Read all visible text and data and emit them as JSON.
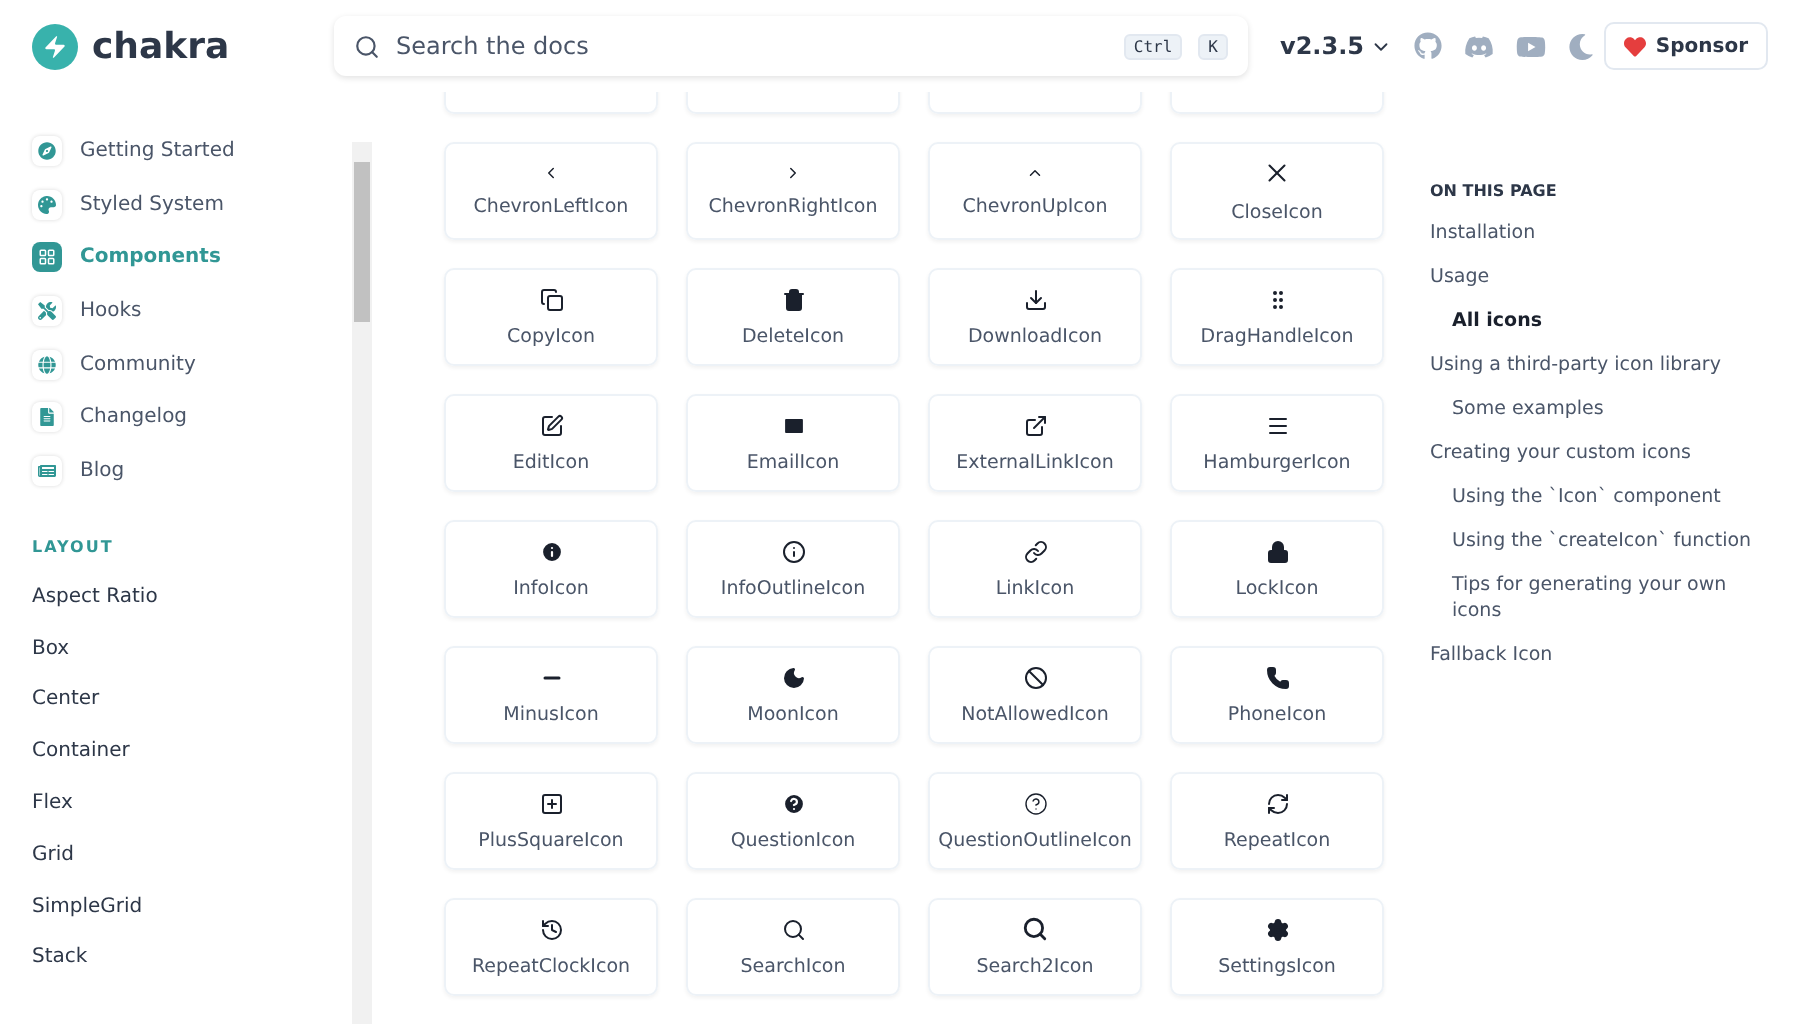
{
  "header": {
    "logo": "chakra",
    "search": {
      "placeholder": "Search the docs",
      "shortcut": [
        "Ctrl",
        "K"
      ]
    },
    "version": "v2.3.5",
    "sponsor": "Sponsor"
  },
  "sidebar": {
    "items": [
      {
        "label": "Getting Started",
        "selected": false
      },
      {
        "label": "Styled System",
        "selected": false
      },
      {
        "label": "Components",
        "selected": true
      },
      {
        "label": "Hooks",
        "selected": false
      },
      {
        "label": "Community",
        "selected": false
      },
      {
        "label": "Changelog",
        "selected": false
      },
      {
        "label": "Blog",
        "selected": false
      }
    ],
    "section": {
      "title": "LAYOUT",
      "items": [
        "Aspect Ratio",
        "Box",
        "Center",
        "Container",
        "Flex",
        "Grid",
        "SimpleGrid",
        "Stack"
      ]
    }
  },
  "icons": [
    "ChevronLeftIcon",
    "ChevronRightIcon",
    "ChevronUpIcon",
    "CloseIcon",
    "CopyIcon",
    "DeleteIcon",
    "DownloadIcon",
    "DragHandleIcon",
    "EditIcon",
    "EmailIcon",
    "ExternalLinkIcon",
    "HamburgerIcon",
    "InfoIcon",
    "InfoOutlineIcon",
    "LinkIcon",
    "LockIcon",
    "MinusIcon",
    "MoonIcon",
    "NotAllowedIcon",
    "PhoneIcon",
    "PlusSquareIcon",
    "QuestionIcon",
    "QuestionOutlineIcon",
    "RepeatIcon",
    "RepeatClockIcon",
    "SearchIcon",
    "Search2Icon",
    "SettingsIcon"
  ],
  "toc": {
    "title": "ON THIS PAGE",
    "items": [
      {
        "label": "Installation",
        "selected": false
      },
      {
        "label": "Usage",
        "selected": false,
        "children": [
          {
            "label": "All icons",
            "selected": true
          }
        ]
      },
      {
        "label": "Using a third-party icon library",
        "selected": false,
        "children": [
          {
            "label": "Some examples",
            "selected": false
          }
        ]
      },
      {
        "label": "Creating your custom icons",
        "selected": false,
        "children": [
          {
            "label": "Using the `Icon` component",
            "selected": false
          },
          {
            "label": "Using the `createIcon` function",
            "selected": false
          },
          {
            "label": "Tips for generating your own icons",
            "selected": false
          }
        ]
      },
      {
        "label": "Fallback Icon",
        "selected": false
      }
    ]
  }
}
